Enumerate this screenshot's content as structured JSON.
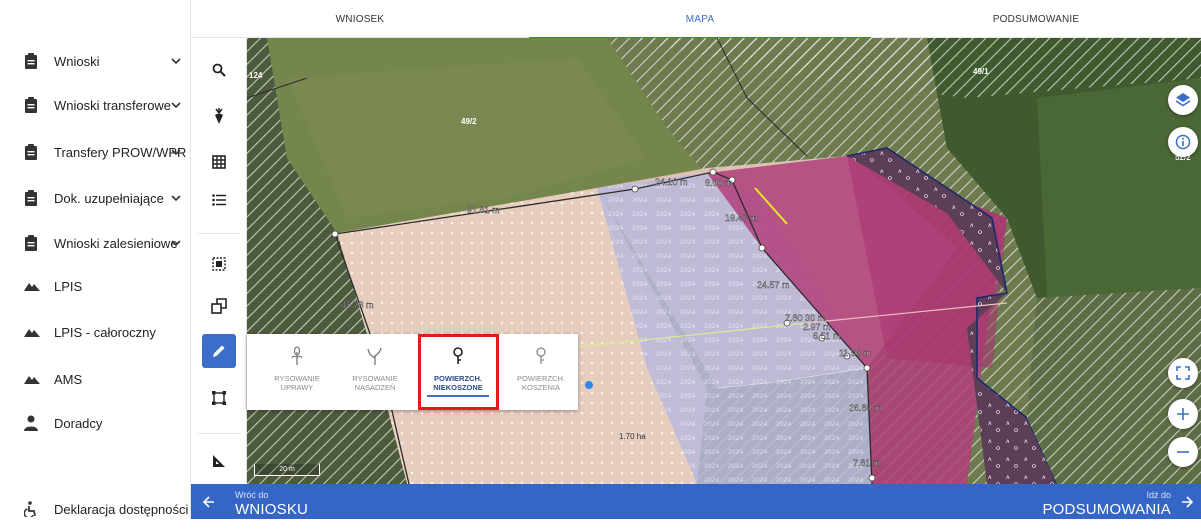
{
  "sidebar": {
    "items": [
      {
        "label": "Wnioski",
        "icon": "clipboard-icon",
        "has_chevron": true
      },
      {
        "label": "Wnioski transferowe",
        "icon": "clipboard-icon",
        "has_chevron": true
      },
      {
        "label": "Transfery PROW/WPR",
        "icon": "clipboard-icon",
        "has_chevron": true
      },
      {
        "label": "Dok. uzupełniające",
        "icon": "clipboard-icon",
        "has_chevron": true
      },
      {
        "label": "Wnioski zalesieniowe",
        "icon": "clipboard-icon",
        "has_chevron": true
      },
      {
        "label": "LPIS",
        "icon": "terrain-icon",
        "has_chevron": false
      },
      {
        "label": "LPIS - całoroczny",
        "icon": "terrain-icon",
        "has_chevron": false
      },
      {
        "label": "AMS",
        "icon": "terrain-icon",
        "has_chevron": false
      },
      {
        "label": "Doradcy",
        "icon": "person-icon",
        "has_chevron": false
      }
    ],
    "footer": {
      "label": "Deklaracja dostępności",
      "icon": "accessibility-icon"
    }
  },
  "tabs": [
    {
      "label": "WNIOSEK",
      "active": false
    },
    {
      "label": "MAPA",
      "active": true
    },
    {
      "label": "PODSUMOWANIE",
      "active": false
    }
  ],
  "tools": [
    "search-icon",
    "crop-icon",
    "grid-icon",
    "list-icon",
    "select-area-icon",
    "copy-icon",
    "pencil-icon",
    "bounding-box-icon",
    "measure-icon"
  ],
  "draw_panel": {
    "options": [
      {
        "label": "RYSOWANIE\nUPRAWY",
        "icon": "plant-icon",
        "selected": false
      },
      {
        "label": "RYSOWANIE\nNASADZEŃ",
        "icon": "sprout-icon",
        "selected": false
      },
      {
        "label": "POWIERZCH.\nNIEKOSZONE",
        "icon": "pin-icon",
        "selected": true
      },
      {
        "label": "POWIERZCH.\nKOSZENIA",
        "icon": "pin-icon",
        "selected": false
      }
    ]
  },
  "map": {
    "parcel_labels": [
      "124",
      "49/2",
      "49/1",
      "52/2"
    ],
    "measurements": [
      "24.10 m",
      "8.00 m",
      "91.81 m",
      "19.47 m",
      "45.78 m",
      "24.57 m",
      "7.80 30 m",
      "2.97 m",
      "6.51 m",
      "11.06 m",
      "26.89 m",
      "7.81 m"
    ],
    "area_label": "1.70 ha",
    "scale_label": "20 m"
  },
  "bottombar": {
    "back_small": "Wróć do",
    "back_big": "WNIOSKU",
    "next_small": "Idź do",
    "next_big": "PODSUMOWANIA"
  },
  "colors": {
    "accent": "#3b6ec9",
    "highlight": "#e11b1b",
    "bottombar": "#3565c6"
  }
}
